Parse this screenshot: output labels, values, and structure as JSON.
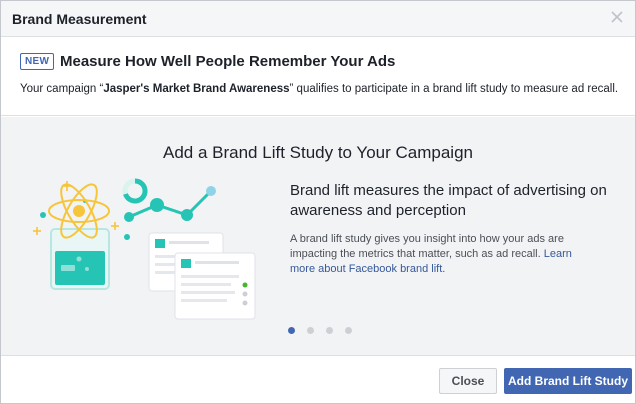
{
  "dialog": {
    "title": "Brand Measurement",
    "close_icon": "close-x-icon"
  },
  "intro": {
    "badge": "NEW",
    "title": "Measure How Well People Remember Your Ads",
    "text_before": "Your campaign “",
    "campaign_name": "Jasper's Market Brand Awareness",
    "text_after": "” qualifies to participate in a brand lift study to measure ad recall."
  },
  "carousel": {
    "heading": "Add a Brand Lift Study to Your Campaign",
    "headline": "Brand lift measures the impact of advertising on awareness and perception",
    "body": "A brand lift study gives you insight into how your ads are impacting the metrics that matter, such as ad recall.",
    "link": "Learn more about Facebook brand lift.",
    "illustration_icon": "brand-lift-illustration",
    "slide_count": 4,
    "active_slide": 1
  },
  "footer": {
    "close_label": "Close",
    "add_label": "Add Brand Lift Study"
  },
  "colors": {
    "accent": "#4267b2",
    "teal": "#26c4b4",
    "yellow": "#f7c53b",
    "link": "#365899"
  }
}
